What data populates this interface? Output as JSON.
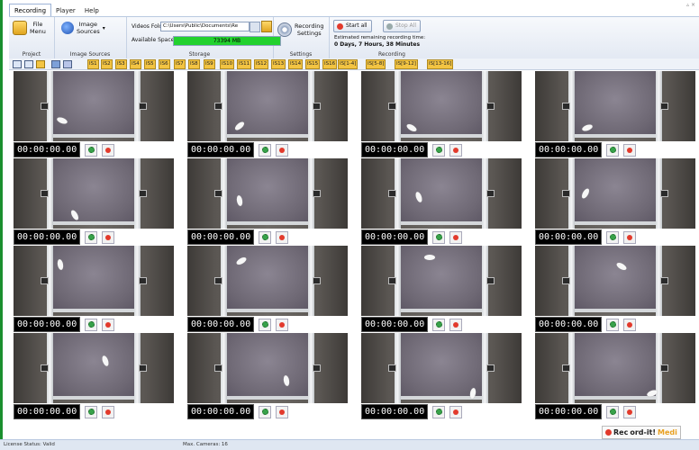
{
  "tabs": [
    "Recording",
    "Player",
    "Help"
  ],
  "window_controls": "▵ ×",
  "ribbon": {
    "project": {
      "group_label": "Project",
      "file_menu": "File\nMenu"
    },
    "image_sources": {
      "group_label": "Image Sources",
      "button": "Image\nSources",
      "arrow": "▾"
    },
    "storage": {
      "group_label": "Storage",
      "videos_folder_label": "Videos Folder:",
      "videos_folder_value": "C:\\Users\\Public\\Documents\\Re",
      "available_space_label": "Available Space:",
      "available_space_value": "73394 MB"
    },
    "settings": {
      "group_label": "Settings",
      "button": "Recording\nSettings"
    },
    "recording": {
      "group_label": "Recording",
      "start_all": "Start all",
      "stop_all": "Stop All",
      "remaining_label": "Estimated remaining recording time:",
      "remaining_value": "0 Days, 7 Hours, 38 Minutes"
    }
  },
  "image_source_buttons": [
    "IS1",
    "IS2",
    "IS3",
    "IS4",
    "IS5",
    "IS6",
    "IS7",
    "IS8",
    "IS9",
    "IS10",
    "IS11",
    "IS12",
    "IS13",
    "IS14",
    "IS15",
    "IS16"
  ],
  "group_buttons": [
    "IS[1-4]",
    "IS[5-8]",
    "IS[9-12]",
    "IS[13-16]"
  ],
  "cameras": [
    {
      "timecode": "00:00:00.00"
    },
    {
      "timecode": "00:00:00.00"
    },
    {
      "timecode": "00:00:00.00"
    },
    {
      "timecode": "00:00:00.00"
    },
    {
      "timecode": "00:00:00.00"
    },
    {
      "timecode": "00:00:00.00"
    },
    {
      "timecode": "00:00:00.00"
    },
    {
      "timecode": "00:00:00.00"
    },
    {
      "timecode": "00:00:00.00"
    },
    {
      "timecode": "00:00:00.00"
    },
    {
      "timecode": "00:00:00.00"
    },
    {
      "timecode": "00:00:00.00"
    },
    {
      "timecode": "00:00:00.00"
    },
    {
      "timecode": "00:00:00.00"
    },
    {
      "timecode": "00:00:00.00"
    },
    {
      "timecode": "00:00:00.00"
    }
  ],
  "brand": {
    "part1": "Rec",
    "part2": "ord-it!",
    "part3": "Medi"
  },
  "status": {
    "license": "License Status: Valid",
    "max_cameras": "Max. Cameras: 16"
  },
  "colors": {
    "accent": "#1a8f2e",
    "space_bar": "#23d12e",
    "is_button": "#f3c442",
    "record": "#e23a2c"
  }
}
